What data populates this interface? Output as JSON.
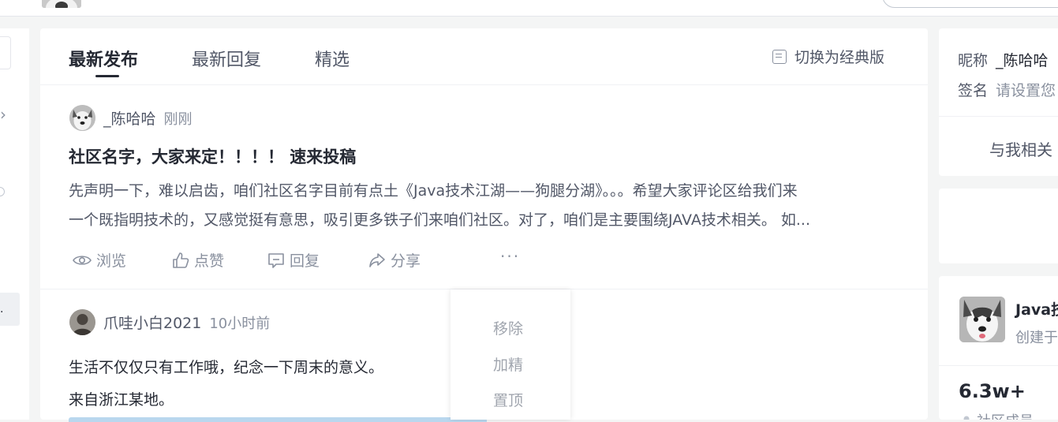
{
  "tabs": {
    "latest": "最新发布",
    "replies": "最新回复",
    "featured": "精选",
    "switch_label": "切换为经典版"
  },
  "posts": [
    {
      "author": "_陈哈哈",
      "time": "刚刚",
      "title": "社区名字，大家来定！！！！ 速来投稿",
      "body_line1": "先声明一下，难以启齿，咱们社区名字目前有点土《Java技术江湖——狗腿分湖》。。。希望大家评论区给我们来",
      "body_line2": "一个既指明技术的，又感觉挺有意思，吸引更多铁子们来咱们社区。对了，咱们是主要围绕JAVA技术相关。 如...",
      "actions": {
        "view": "浏览",
        "like": "点赞",
        "reply": "回复",
        "share": "分享",
        "more": "···"
      }
    },
    {
      "author": "爪哇小白2021",
      "time": "10小时前",
      "body_line1": "生活不仅仅只有工作哦，纪念一下周末的意义。",
      "body_line2": "来自浙江某地。"
    }
  ],
  "admin_menu": {
    "remove": "移除",
    "feature": "加精",
    "pin": "置顶"
  },
  "sidebar_left": {
    "chevron": "›",
    "active_item": "."
  },
  "profile": {
    "nickname_label": "昵称",
    "nickname_value": "_陈哈哈",
    "signature_label": "签名",
    "signature_placeholder": "请设置您",
    "related_link": "与我相关"
  },
  "community": {
    "name": "Java技",
    "created": "创建于",
    "members_count": "6.3w+",
    "members_label": "社区成员"
  },
  "colors": {
    "primary_text": "#252933",
    "secondary_text": "#515767",
    "muted_text": "#8a919f",
    "page_bg": "#f4f5f5"
  }
}
